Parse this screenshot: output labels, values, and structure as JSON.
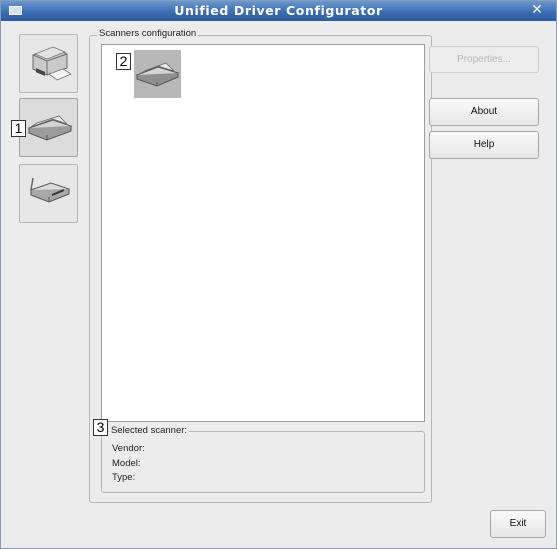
{
  "window": {
    "title": "Unified Driver Configurator",
    "close_glyph": "✕"
  },
  "sidebar": {
    "items": [
      {
        "name": "printers",
        "icon": "printer-icon",
        "active": false
      },
      {
        "name": "scanners",
        "icon": "scanner-icon",
        "active": true
      },
      {
        "name": "ports",
        "icon": "port-icon",
        "active": false
      }
    ]
  },
  "callouts": {
    "one": "1",
    "two": "2",
    "three": "3"
  },
  "scanners_config": {
    "group_label": "Scanners configuration",
    "items": [
      {
        "icon": "scanner-icon",
        "selected": true
      }
    ]
  },
  "selected_scanner": {
    "group_label": "Selected scanner:",
    "vendor_label": "Vendor:",
    "model_label": "Model:",
    "type_label": "Type:"
  },
  "buttons": {
    "properties": "Properties...",
    "about": "About",
    "help": "Help",
    "exit": "Exit"
  },
  "colors": {
    "titlebar": "#3b6db1",
    "window_bg": "#ececec"
  }
}
